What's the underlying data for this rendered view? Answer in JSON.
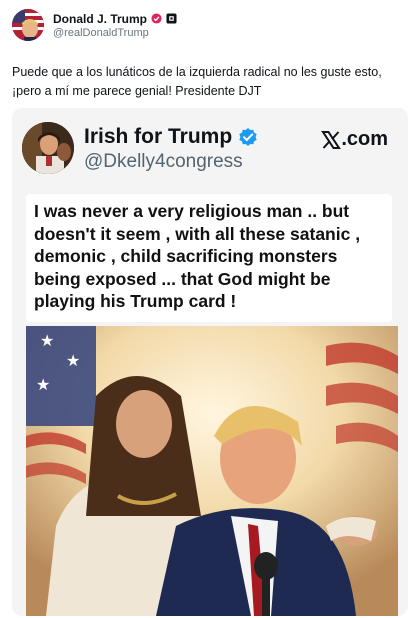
{
  "post": {
    "author_name": "Donald J. Trump",
    "author_handle": "@realDonaldTrump",
    "text": "Puede que a los lunáticos de la izquierda radical no les guste esto, ¡pero a mí me parece genial! Presidente DJT",
    "verified_badge_color": "#e0245e"
  },
  "embed": {
    "name": "Irish for Trump",
    "handle": "@Dkelly4congress",
    "source": ".com",
    "quote": "I was never a very religious man .. but doesn't it seem , with all these satanic , demonic , child sacrificing monsters being exposed ... that God might be playing his Trump card !",
    "verified_badge_color": "#1d9bf0"
  },
  "icons": {
    "author_verified": "verified-badge-icon",
    "author_affiliate": "affiliate-square-icon",
    "embed_verified": "verified-checkmark-icon",
    "x_logo": "x-logo-icon"
  }
}
